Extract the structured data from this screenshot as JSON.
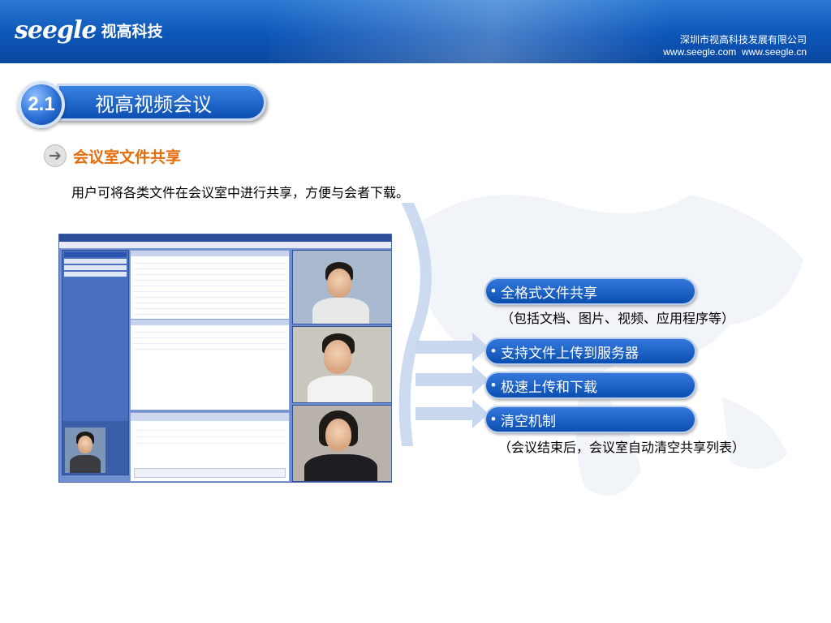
{
  "header": {
    "logo_latin": "seegle",
    "logo_cn": "视高科技",
    "company_name": "深圳市视高科技发展有限公司",
    "company_urls": "www.seegle.com  www.seegle.cn"
  },
  "section": {
    "number": "2.1",
    "title": "视高视频会议"
  },
  "subsection": {
    "title": "会议室文件共享",
    "description": "用户可将各类文件在会议室中进行共享，方便与会者下载。"
  },
  "features": [
    {
      "label": "全格式文件共享",
      "note": "（包括文档、图片、视频、应用程序等）"
    },
    {
      "label": "支持文件上传到服务器",
      "note": ""
    },
    {
      "label": "极速上传和下载",
      "note": ""
    },
    {
      "label": "清空机制",
      "note": "（会议结束后，会议室自动清空共享列表）"
    }
  ],
  "bullet": "•",
  "colors": {
    "brand_blue": "#0b4fb2",
    "accent_orange": "#e46c0a"
  }
}
